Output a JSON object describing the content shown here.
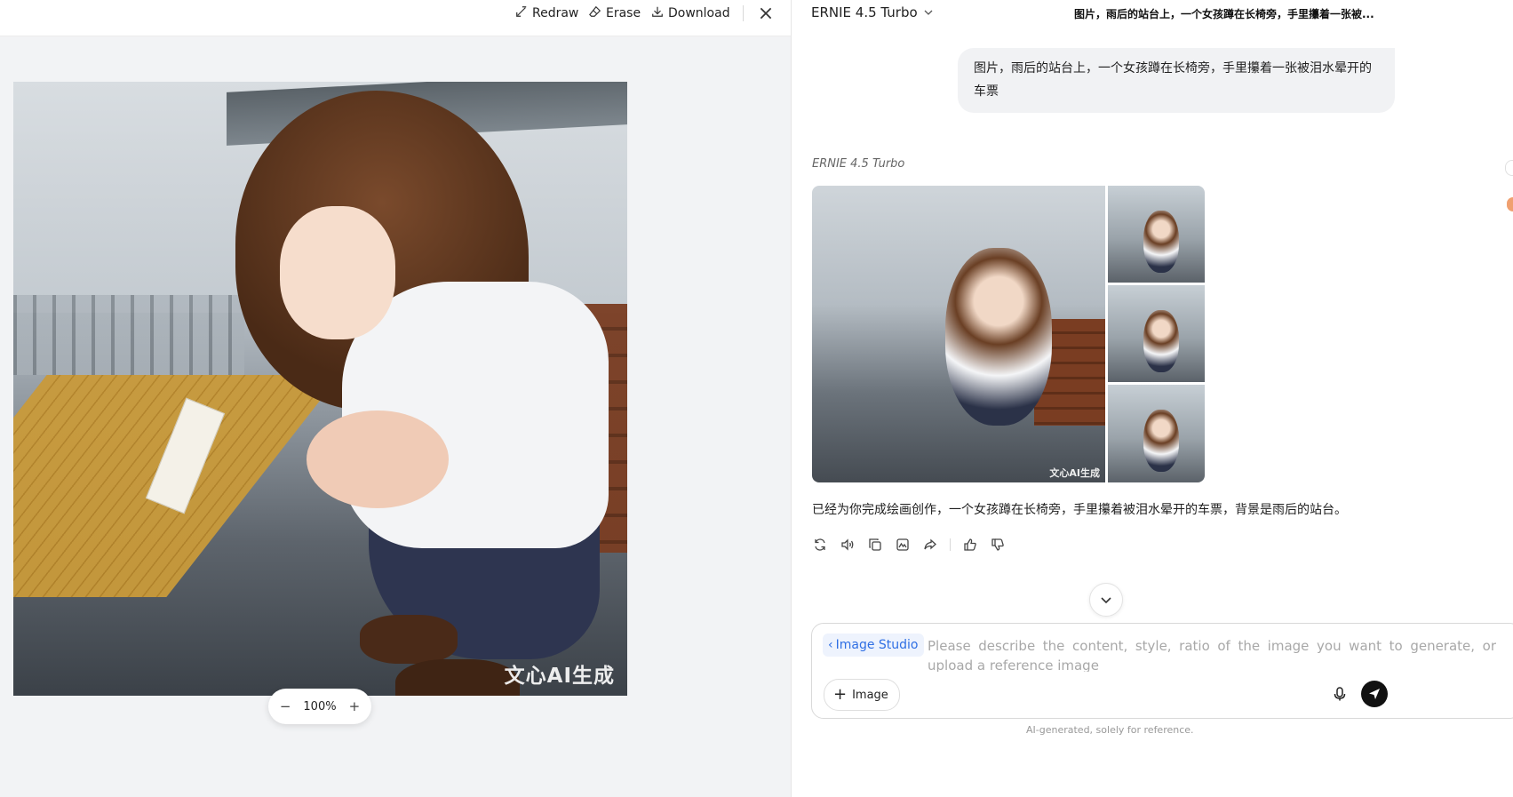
{
  "toolbar": {
    "redraw_label": "Redraw",
    "erase_label": "Erase",
    "download_label": "Download"
  },
  "viewer": {
    "watermark": "文心AI生成",
    "zoom_level": "100%"
  },
  "chat": {
    "model_name": "ERNIE 4.5 Turbo",
    "conversation_title": "图片，雨后的站台上，一个女孩蹲在长椅旁，手里攥着一张被...",
    "user_message": "图片，雨后的站台上，一个女孩蹲在长椅旁，手里攥着一张被泪水晕开的车票",
    "bot_name": "ERNIE 4.5 Turbo",
    "thumb_watermark": "文心AI生成",
    "reply": "已经为你完成绘画创作，一个女孩蹲在长椅旁，手里攥着被泪水晕开的车票，背景是雨后的站台。",
    "actions": [
      "regenerate-icon",
      "read-aloud-icon",
      "copy-icon",
      "image-edit-icon",
      "share-icon",
      "thumbs-up-icon",
      "thumbs-down-icon"
    ]
  },
  "composer": {
    "studio_label": "Image Studio",
    "placeholder": "Please describe the content, style, ratio of the image you want to generate, or upload a reference image",
    "image_button_label": "Image"
  },
  "disclaimer": "AI-generated, solely for reference."
}
